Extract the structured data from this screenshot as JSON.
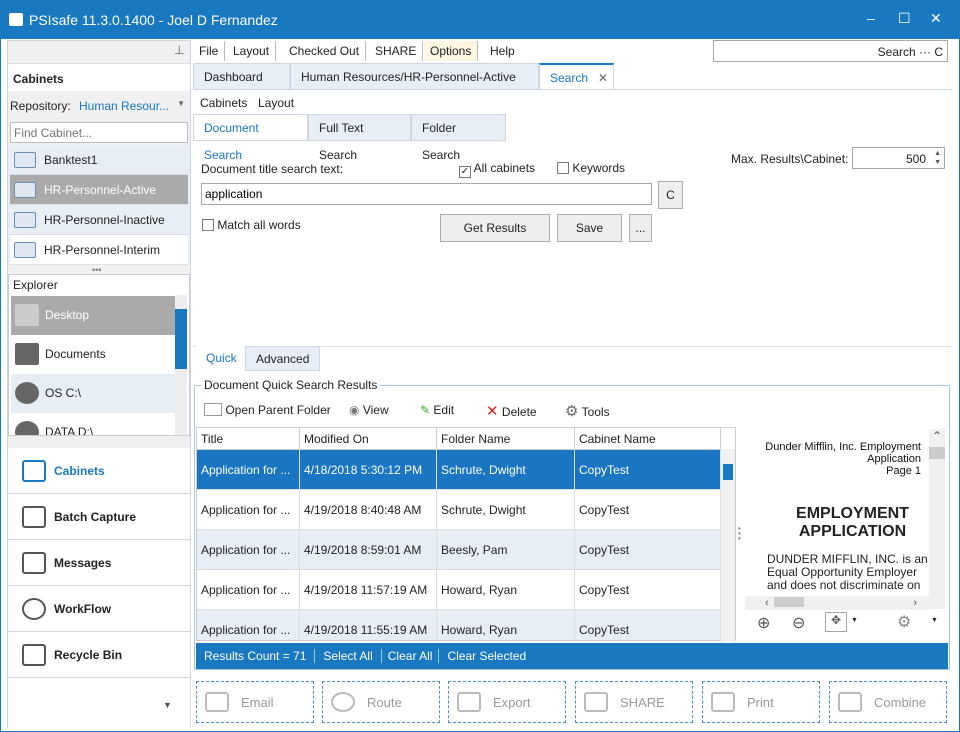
{
  "window": {
    "title": "PSIsafe 11.3.0.1400 - Joel D Fernandez",
    "minimize": "–",
    "maximize": "☐",
    "close": "✕"
  },
  "left": {
    "pin": "⊥",
    "cabinets_header": "Cabinets",
    "repository_label": "Repository:",
    "repository_value": "Human Resour...",
    "find_placeholder": "Find Cabinet...",
    "cabinets": [
      "Banktest1",
      "HR-Personnel-Active",
      "HR-Personnel-Inactive",
      "HR-Personnel-Interim"
    ],
    "explorer_header": "Explorer",
    "explorer_items": [
      "Desktop",
      "Documents",
      "OS C:\\",
      "DATA D:\\"
    ],
    "nav": [
      "Cabinets",
      "Batch Capture",
      "Messages",
      "WorkFlow",
      "Recycle Bin"
    ]
  },
  "menu": [
    "File",
    "Layout",
    "Checked Out",
    "SHARE",
    "Options",
    "Help"
  ],
  "search_box": {
    "label": "Search ···",
    "clear": "C"
  },
  "tabs": [
    "Dashboard",
    "Human Resources/HR-Personnel-Active",
    "Search"
  ],
  "subnav": [
    "Cabinets",
    "Layout"
  ],
  "search_tabs": [
    "Document Search",
    "Full Text Search",
    "Folder Search"
  ],
  "form": {
    "title_label": "Document title search text:",
    "all_cabinets": "All cabinets",
    "all_cabinets_checked": true,
    "keywords": "Keywords",
    "keywords_checked": false,
    "max_label": "Max. Results\\Cabinet:",
    "max_value": "500",
    "query": "application",
    "clear": "C",
    "match_all": "Match all words",
    "match_all_checked": false,
    "get_results": "Get Results",
    "save": "Save",
    "more": "..."
  },
  "mode_tabs": [
    "Quick",
    "Advanced"
  ],
  "results": {
    "group_title": "Document Quick Search Results",
    "toolbar": [
      "Open Parent Folder",
      "View",
      "Edit",
      "Delete",
      "Tools"
    ],
    "columns": [
      "Title",
      "Modified On",
      "Folder Name",
      "Cabinet Name"
    ],
    "rows": [
      [
        "Application for ...",
        "4/18/2018 5:30:12 PM",
        "Schrute, Dwight",
        "CopyTest"
      ],
      [
        "Application for ...",
        "4/19/2018 8:40:48 AM",
        "Schrute, Dwight",
        "CopyTest"
      ],
      [
        "Application for ...",
        "4/19/2018 8:59:01 AM",
        "Beesly, Pam",
        "CopyTest"
      ],
      [
        "Application for ...",
        "4/19/2018 11:57:19 AM",
        "Howard, Ryan",
        "CopyTest"
      ],
      [
        "Application for ...",
        "4/19/2018 11:55:19 AM",
        "Howard, Ryan",
        "CopyTest"
      ]
    ],
    "status": [
      "Results Count = 71",
      "Select All",
      "Clear All",
      "Clear Selected"
    ]
  },
  "preview": {
    "header": [
      "Dunder Mifflin, Inc. Employment",
      "Application",
      "Page 1"
    ],
    "title": [
      "EMPLOYMENT",
      "APPLICATION"
    ],
    "body": [
      "DUNDER MIFFLIN, INC. is an",
      "Equal Opportunity Employer",
      "and does not discriminate on"
    ]
  },
  "bottom_buttons": [
    "Email",
    "Route",
    "Export",
    "SHARE",
    "Print",
    "Combine"
  ],
  "colors": {
    "accent": "#1878c0",
    "selected_row": "#1a75c2"
  }
}
